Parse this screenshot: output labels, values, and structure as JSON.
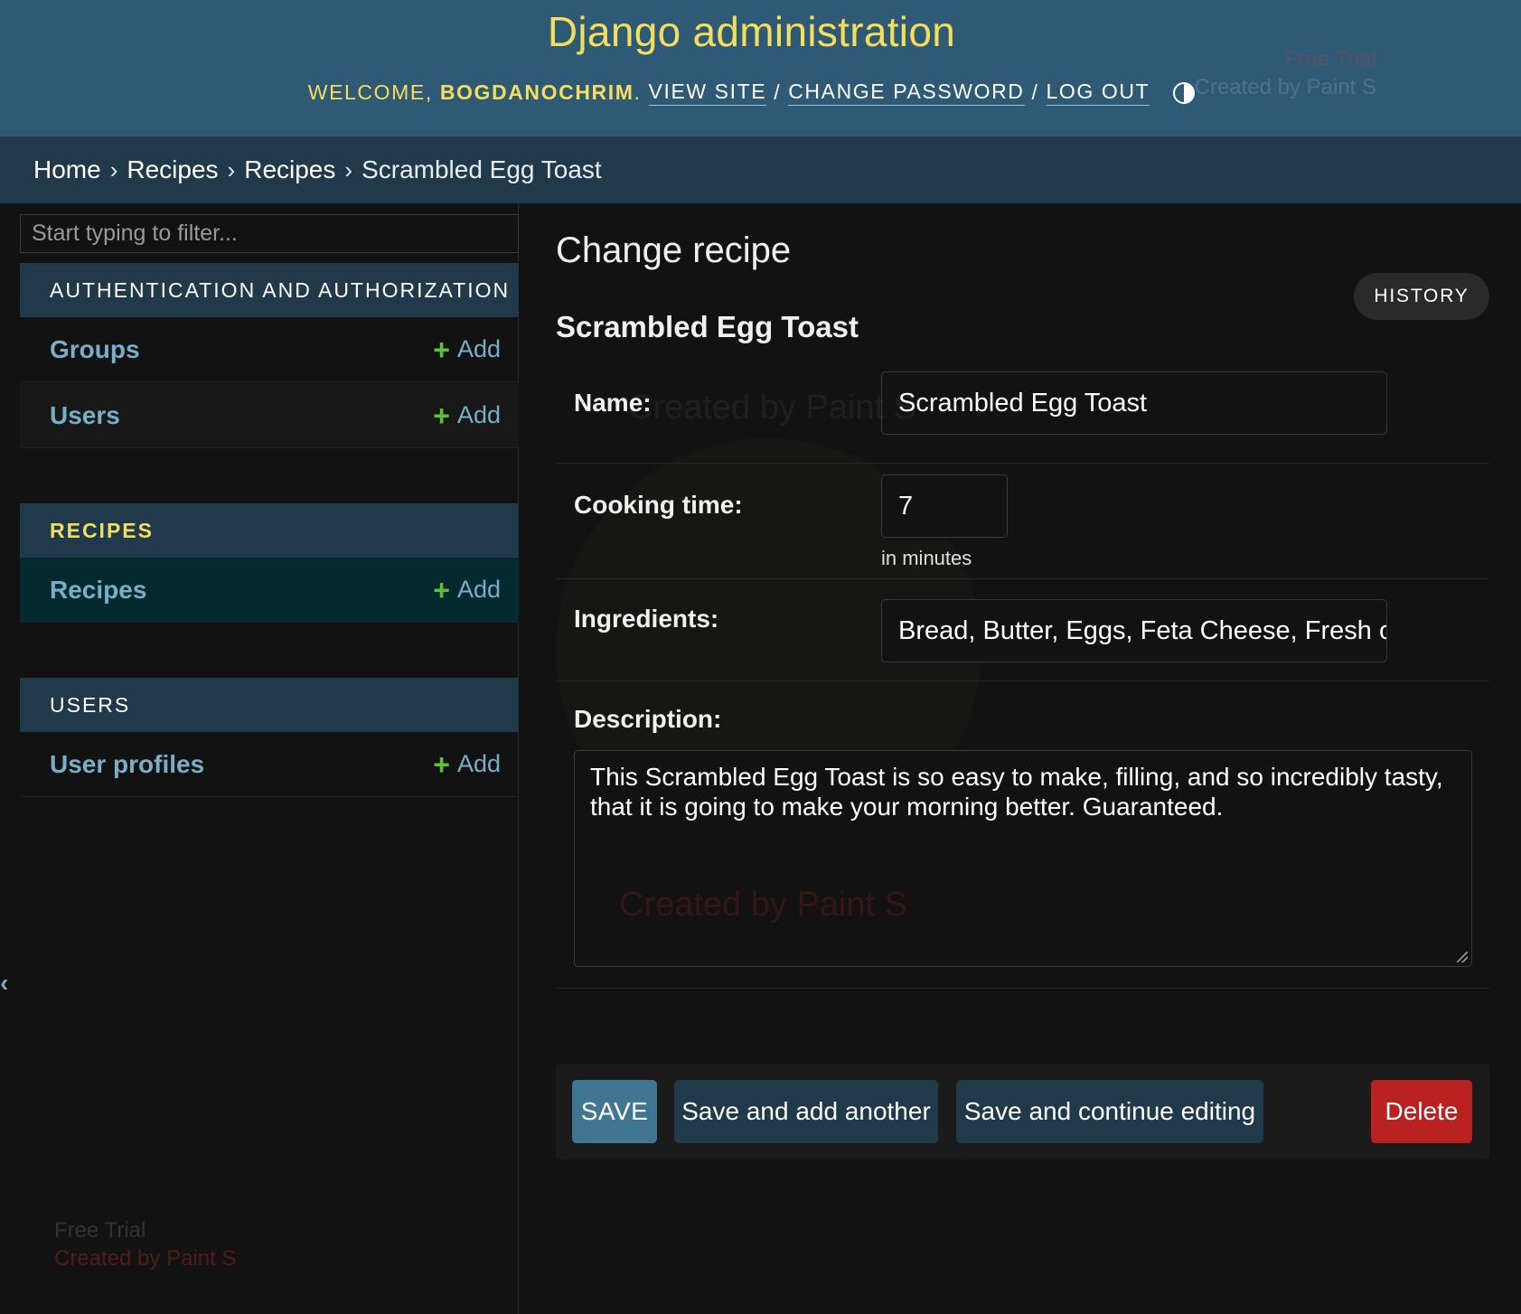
{
  "header": {
    "site_name": "Django administration",
    "welcome": "WELCOME,",
    "username": "BOGDANOCHRIM",
    "username_suffix": ".",
    "view_site": "VIEW SITE",
    "change_password": "CHANGE PASSWORD",
    "log_out": "LOG OUT",
    "separator": "/",
    "theme_icon": "theme-toggle-icon"
  },
  "watermarks": {
    "line1": "Free Trial",
    "line2": "Created by Paint S"
  },
  "breadcrumbs": {
    "items": [
      "Home",
      "Recipes",
      "Recipes"
    ],
    "current": "Scrambled Egg Toast",
    "arrow": "›"
  },
  "sidebar": {
    "filter_placeholder": "Start typing to filter...",
    "toggle_glyph": "‹",
    "modules": [
      {
        "caption": "AUTHENTICATION AND AUTHORIZATION",
        "models": [
          {
            "name": "Groups",
            "add": "Add"
          },
          {
            "name": "Users",
            "add": "Add"
          }
        ]
      },
      {
        "caption": "RECIPES",
        "models": [
          {
            "name": "Recipes",
            "add": "Add"
          }
        ]
      },
      {
        "caption": "USERS",
        "models": [
          {
            "name": "User profiles",
            "add": "Add"
          }
        ]
      }
    ]
  },
  "content": {
    "page_title": "Change recipe",
    "history": "HISTORY",
    "object_title": "Scrambled Egg Toast",
    "fields": {
      "name": {
        "label": "Name:",
        "value": "Scrambled Egg Toast"
      },
      "cooking_time": {
        "label": "Cooking time:",
        "value": "7",
        "help": "in minutes"
      },
      "ingredients": {
        "label": "Ingredients:",
        "value": "Bread, Butter, Eggs, Feta Cheese, Fresh c"
      },
      "description": {
        "label": "Description:",
        "value": "This Scrambled Egg Toast is so easy to make, filling, and so incredibly tasty, that it is going to make your morning better. Guaranteed."
      }
    },
    "buttons": {
      "save": "SAVE",
      "save_add_another": "Save and add another",
      "save_continue": "Save and continue editing",
      "delete": "Delete"
    }
  },
  "colors": {
    "header_bg": "#2f5a76",
    "breadcrumb_bg": "#20394b",
    "accent_yellow": "#f5dd5d",
    "link_blue": "#79aec8",
    "add_green": "#5ec13a",
    "delete_red": "#ba2121",
    "save_blue": "#417690"
  }
}
